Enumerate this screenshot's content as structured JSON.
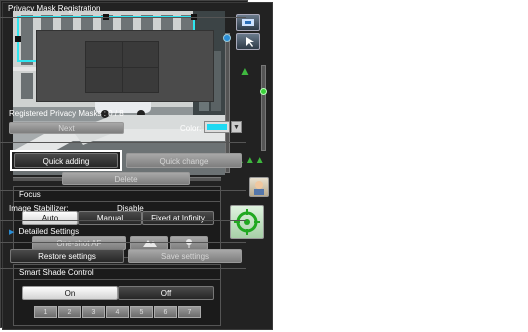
{
  "focus": {
    "title": "Focus",
    "modes": [
      "Auto",
      "Manual",
      "Fixed at Infinity"
    ],
    "one_shot_af": "One-shot AF"
  },
  "smart_shade": {
    "title": "Smart Shade Control",
    "on": "On",
    "off": "Off",
    "levels": [
      "1",
      "2",
      "3",
      "4",
      "5",
      "6",
      "7"
    ]
  },
  "privacy": {
    "title": "Privacy Mask Registration",
    "registered_label": "Registered Privacy Masks : 0 / 8",
    "next": "Next",
    "color_label": "Color:",
    "color_value": "#1fd9f2",
    "quick_adding": "Quick adding",
    "quick_change": "Quick change",
    "delete": "Delete"
  },
  "stabilizer": {
    "label": "Image Stabilizer:",
    "value": "Disable"
  },
  "detailed": {
    "label": "Detailed Settings"
  },
  "actions": {
    "restore": "Restore settings",
    "save": "Save settings"
  },
  "icons": {
    "zoom_wide": "tree-small-icon",
    "zoom_tele": "tree-cluster-icon",
    "toolbar_1": "pan-tilt-icon",
    "toolbar_2": "cursor-icon",
    "portrait": "portrait-icon",
    "target": "crosshair-target-icon",
    "mountain": "mountain-icon",
    "flower": "flower-icon",
    "dropdown": "dropdown-arrow-icon",
    "triangle": "triangle-right-icon"
  },
  "colors": {
    "accent": "#2b8ed6",
    "mask_outline": "#2ee6f0",
    "highlight": "#ffffff"
  }
}
